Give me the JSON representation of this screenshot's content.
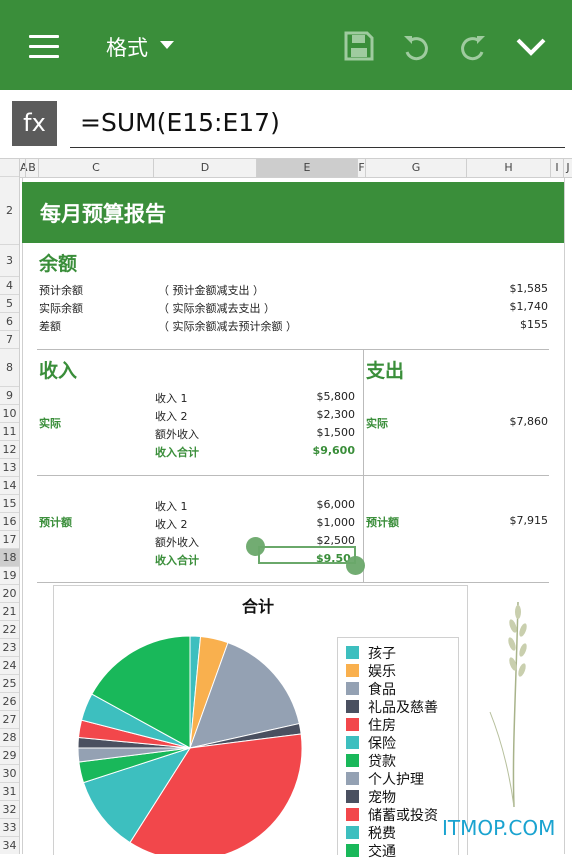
{
  "toolbar": {
    "format_label": "格式",
    "icons": [
      "menu-icon",
      "save-icon",
      "undo-icon",
      "redo-icon",
      "collapse-chevron-icon"
    ],
    "color": "#3a8e3a"
  },
  "formula_bar": {
    "fx_label": "fx",
    "formula": "=SUM(E15:E17)"
  },
  "columns": [
    "A",
    "B",
    "C",
    "D",
    "E",
    "F",
    "G",
    "H",
    "I",
    "J"
  ],
  "selected_column": "E",
  "rows": [
    "2",
    "3",
    "4",
    "5",
    "6",
    "7",
    "8",
    "9",
    "10",
    "11",
    "12",
    "13",
    "14",
    "15",
    "16",
    "17",
    "18",
    "19",
    "20",
    "21",
    "22",
    "23",
    "24",
    "25",
    "26",
    "27",
    "28",
    "29",
    "30",
    "31",
    "32",
    "33",
    "34"
  ],
  "selected_row": "18",
  "report": {
    "title": "每月预算报告",
    "balance": {
      "heading": "余额",
      "rows": [
        {
          "label": "预计余额",
          "note": "（ 预计金额减支出 ）",
          "value": "$1,585"
        },
        {
          "label": "实际余额",
          "note": "（ 实际余额减去支出 ）",
          "value": "$1,740"
        },
        {
          "label": "差额",
          "note": "（ 实际余额减去预计余额 ）",
          "value": "$155"
        }
      ]
    },
    "income": {
      "heading": "收入",
      "actual": {
        "label": "实际",
        "rows": [
          {
            "label": "收入 1",
            "value": "$5,800"
          },
          {
            "label": "收入 2",
            "value": "$2,300"
          },
          {
            "label": "额外收入",
            "value": "$1,500"
          }
        ],
        "total_label": "收入合计",
        "total_value": "$9,600"
      },
      "projected": {
        "label": "预计额",
        "rows": [
          {
            "label": "收入 1",
            "value": "$6,000"
          },
          {
            "label": "收入 2",
            "value": "$1,000"
          },
          {
            "label": "额外收入",
            "value": "$2,500"
          }
        ],
        "total_label": "收入合计",
        "total_value": "$9,50"
      }
    },
    "expense": {
      "heading": "支出",
      "actual_label": "实际",
      "actual_value": "$7,860",
      "projected_label": "预计额",
      "projected_value": "$7,915"
    }
  },
  "chart": {
    "title": "合计",
    "legend": [
      {
        "label": "孩子",
        "color": "#3dbfbf"
      },
      {
        "label": "娱乐",
        "color": "#f9b04e"
      },
      {
        "label": "食品",
        "color": "#94a1b3"
      },
      {
        "label": "礼品及慈善",
        "color": "#4a5060"
      },
      {
        "label": "住房",
        "color": "#f2474b"
      },
      {
        "label": "保险",
        "color": "#3dbfbf"
      },
      {
        "label": "贷款",
        "color": "#19b85a"
      },
      {
        "label": "个人护理",
        "color": "#94a1b3"
      },
      {
        "label": "宠物",
        "color": "#4a5060"
      },
      {
        "label": "储蓄或投资",
        "color": "#f2474b"
      },
      {
        "label": "税费",
        "color": "#3dbfbf"
      },
      {
        "label": "交通",
        "color": "#19b85a"
      }
    ]
  },
  "chart_data": {
    "type": "pie",
    "title": "合计",
    "categories": [
      "孩子",
      "娱乐",
      "食品",
      "礼品及慈善",
      "住房",
      "保险",
      "贷款",
      "个人护理",
      "宠物",
      "储蓄或投资",
      "税费",
      "交通"
    ],
    "values": [
      1.5,
      4,
      16,
      1.5,
      36,
      11,
      3,
      2,
      1.5,
      2.5,
      4,
      17
    ]
  },
  "watermark": "ITMOP.COM"
}
